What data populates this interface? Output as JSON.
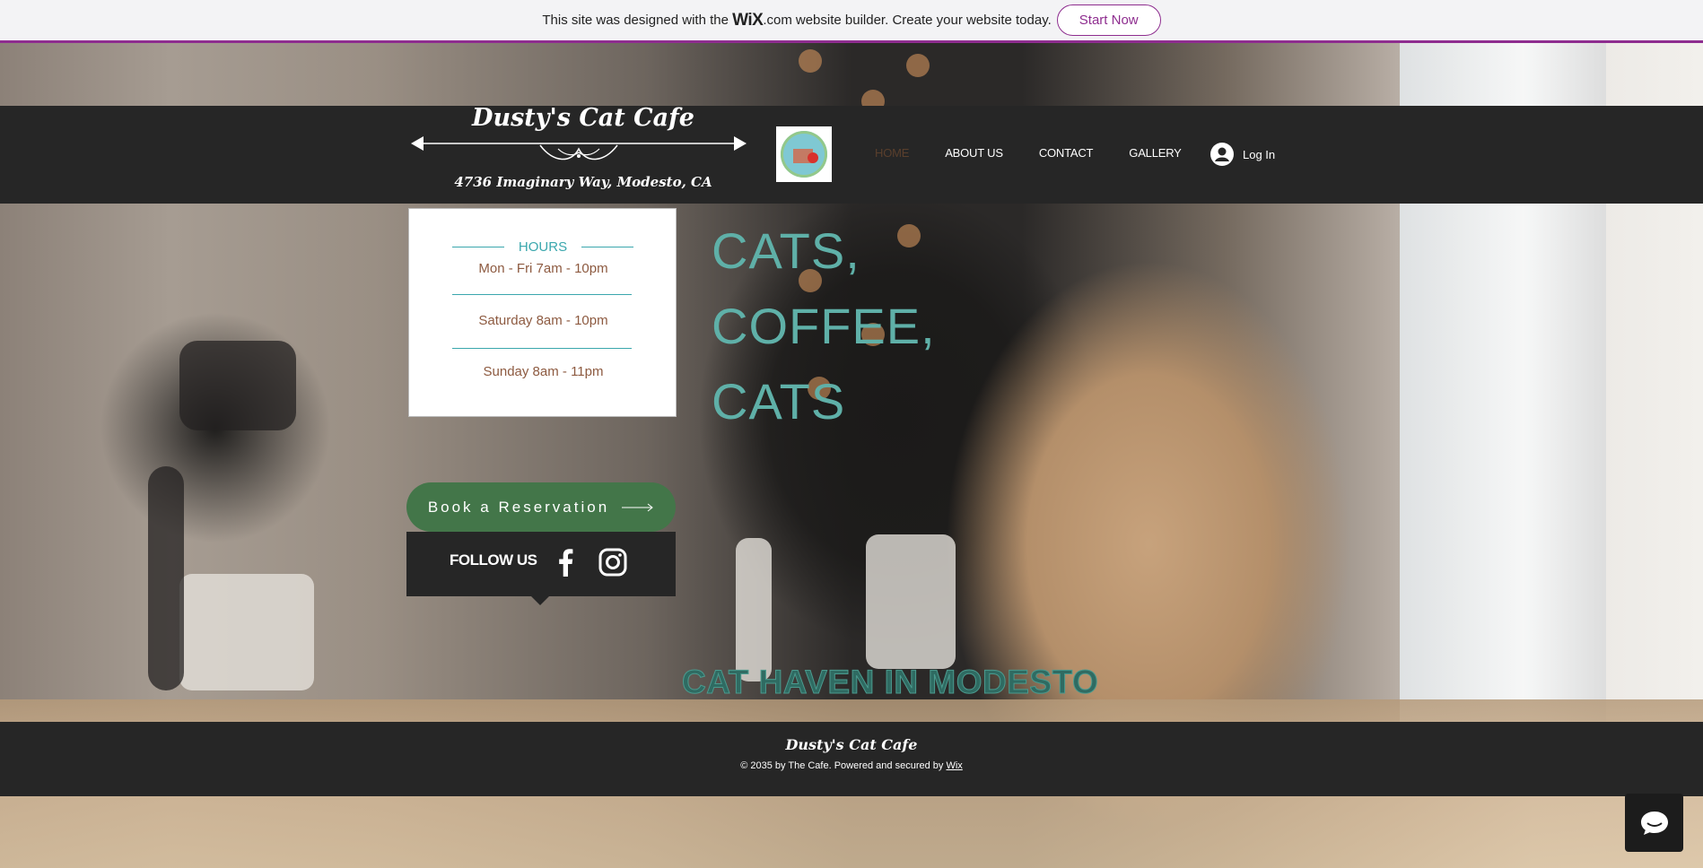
{
  "wix_banner": {
    "text_before": "This site was designed with the",
    "logo": "WiX",
    "domain_suffix": ".com",
    "text_after": "website builder. Create your website today.",
    "cta": "Start Now"
  },
  "header": {
    "brand_title": "Dusty's Cat Cafe",
    "address": "4736 Imaginary Way, Modesto, CA",
    "nav": [
      "HOME",
      "ABOUT US",
      "CONTACT",
      "GALLERY"
    ],
    "active_nav": "HOME",
    "login_label": "Log In"
  },
  "hours": {
    "title": "HOURS",
    "rows": [
      "Mon - Fri 7am - 10pm",
      "Saturday 8am - 10pm",
      "Sunday 8am - 11pm"
    ]
  },
  "headline": [
    "CATS,",
    "COFFEE,",
    "CATS"
  ],
  "reservation": {
    "label": "Book a Reservation"
  },
  "follow": {
    "label": "FOLLOW US",
    "icons": [
      "facebook-icon",
      "instagram-icon"
    ]
  },
  "tagline": "CAT HAVEN IN MODESTO",
  "footer": {
    "title": "Dusty's Cat Cafe",
    "copyright": "© 2035 by The Cafe. Powered and secured by",
    "link": "Wix"
  },
  "colors": {
    "banner_accent": "#8e2d8f",
    "header_bg": "#262626",
    "hours_accent": "#3aa7ad",
    "hours_text": "#8d5a40",
    "reserve_green": "#437649",
    "headline_teal": "#5fb0a8"
  }
}
